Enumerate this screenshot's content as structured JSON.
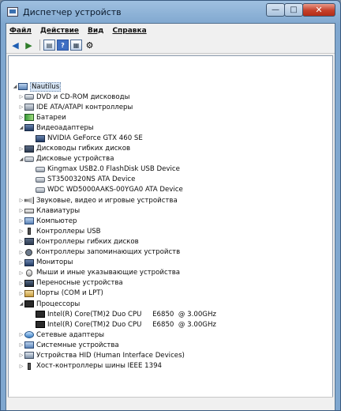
{
  "window": {
    "title": "Диспетчер устройств",
    "minimize_glyph": "—",
    "maximize_glyph": "□",
    "close_glyph": "✕"
  },
  "menu": {
    "file": "Файл",
    "action": "Действие",
    "view": "Вид",
    "help": "Справка"
  },
  "toolbar": {
    "back_glyph": "◀",
    "forward_glyph": "▶",
    "properties_glyph": "▤",
    "help_glyph": "?",
    "view_glyph": "▦",
    "scan_glyph": "⚙"
  },
  "tree": {
    "root": "Nautilus",
    "items": [
      {
        "label": "DVD и CD-ROM дисководы",
        "icon": "drive"
      },
      {
        "label": "IDE ATA/ATAPI контроллеры",
        "icon": "device"
      },
      {
        "label": "Батареи",
        "icon": "battery"
      },
      {
        "label": "Видеоадаптеры",
        "icon": "monitor"
      },
      {
        "label": "NVIDIA GeForce GTX 460 SE",
        "icon": "monitor"
      },
      {
        "label": "Дисководы гибких дисков",
        "icon": "floppy"
      },
      {
        "label": "Дисковые устройства",
        "icon": "drive"
      },
      {
        "label": "Kingmax USB2.0 FlashDisk USB Device",
        "icon": "drive"
      },
      {
        "label": "ST3500320NS ATA Device",
        "icon": "drive"
      },
      {
        "label": "WDC WD5000AAKS-00YGA0 ATA Device",
        "icon": "drive"
      },
      {
        "label": "Звуковые, видео и игровые устройства",
        "icon": "sound"
      },
      {
        "label": "Клавиатуры",
        "icon": "keyboard"
      },
      {
        "label": "Компьютер",
        "icon": "computer"
      },
      {
        "label": "Контроллеры USB",
        "icon": "usb"
      },
      {
        "label": "Контроллеры гибких дисков",
        "icon": "floppy"
      },
      {
        "label": "Контроллеры запоминающих устройств",
        "icon": "gear"
      },
      {
        "label": "Мониторы",
        "icon": "monitor"
      },
      {
        "label": "Мыши и иные указывающие устройства",
        "icon": "mouse"
      },
      {
        "label": "Переносные устройства",
        "icon": "portable"
      },
      {
        "label": "Порты (COM и LPT)",
        "icon": "port"
      },
      {
        "label": "Процессоры",
        "icon": "chip"
      },
      {
        "label": "Intel(R) Core(TM)2 Duo CPU     E6850  @ 3.00GHz",
        "icon": "chip"
      },
      {
        "label": "Intel(R) Core(TM)2 Duo CPU     E6850  @ 3.00GHz",
        "icon": "chip"
      },
      {
        "label": "Сетевые адаптеры",
        "icon": "net"
      },
      {
        "label": "Системные устройства",
        "icon": "computer"
      },
      {
        "label": "Устройства HID (Human Interface Devices)",
        "icon": "hid"
      },
      {
        "label": "Хост-контроллеры шины IEEE 1394",
        "icon": "usb"
      }
    ],
    "expanded_glyph": "◢",
    "collapsed_glyph": "▷"
  }
}
